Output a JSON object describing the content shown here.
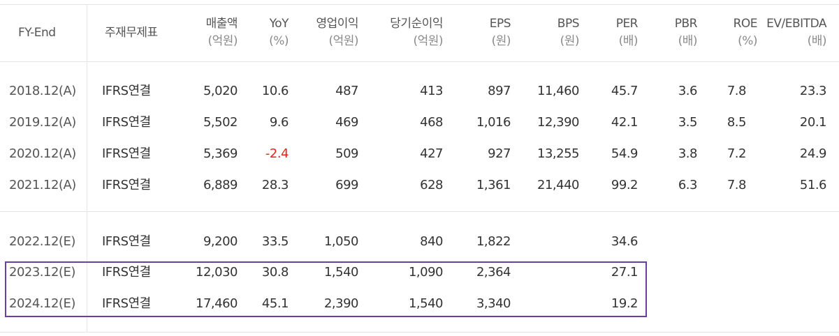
{
  "table": {
    "headers": [
      {
        "line1": "FY-End",
        "line2": ""
      },
      {
        "line1": "주재무제표",
        "line2": ""
      },
      {
        "line1": "매출액",
        "line2": "(억원)"
      },
      {
        "line1": "YoY",
        "line2": "(%)"
      },
      {
        "line1": "영업이익",
        "line2": "(억원)"
      },
      {
        "line1": "당기순이익",
        "line2": "(억원)"
      },
      {
        "line1": "EPS",
        "line2": "(원)"
      },
      {
        "line1": "BPS",
        "line2": "(원)"
      },
      {
        "line1": "PER",
        "line2": "(배)"
      },
      {
        "line1": "PBR",
        "line2": "(배)"
      },
      {
        "line1": "ROE",
        "line2": "(%)"
      },
      {
        "line1": "EV/EBITDA",
        "line2": "(배)"
      }
    ],
    "actual_rows": [
      {
        "fy": "2018.12(A)",
        "gaap": "IFRS연결",
        "sales": "5,020",
        "yoy": "10.6",
        "op": "487",
        "net": "413",
        "eps": "897",
        "bps": "11,460",
        "per": "45.7",
        "pbr": "3.6",
        "roe": "7.8",
        "ev": "23.3"
      },
      {
        "fy": "2019.12(A)",
        "gaap": "IFRS연결",
        "sales": "5,502",
        "yoy": "9.6",
        "op": "469",
        "net": "468",
        "eps": "1,016",
        "bps": "12,390",
        "per": "42.1",
        "pbr": "3.5",
        "roe": "8.5",
        "ev": "20.1"
      },
      {
        "fy": "2020.12(A)",
        "gaap": "IFRS연결",
        "sales": "5,369",
        "yoy": "-2.4",
        "op": "509",
        "net": "427",
        "eps": "927",
        "bps": "13,255",
        "per": "54.9",
        "pbr": "3.8",
        "roe": "7.2",
        "ev": "24.9"
      },
      {
        "fy": "2021.12(A)",
        "gaap": "IFRS연결",
        "sales": "6,889",
        "yoy": "28.3",
        "op": "699",
        "net": "628",
        "eps": "1,361",
        "bps": "21,440",
        "per": "99.2",
        "pbr": "6.3",
        "roe": "7.8",
        "ev": "51.6"
      }
    ],
    "estimate_rows": [
      {
        "fy": "2022.12(E)",
        "gaap": "IFRS연결",
        "sales": "9,200",
        "yoy": "33.5",
        "op": "1,050",
        "net": "840",
        "eps": "1,822",
        "bps": "",
        "per": "34.6",
        "pbr": "",
        "roe": "",
        "ev": ""
      },
      {
        "fy": "2023.12(E)",
        "gaap": "IFRS연결",
        "sales": "12,030",
        "yoy": "30.8",
        "op": "1,540",
        "net": "1,090",
        "eps": "2,364",
        "bps": "",
        "per": "27.1",
        "pbr": "",
        "roe": "",
        "ev": ""
      },
      {
        "fy": "2024.12(E)",
        "gaap": "IFRS연결",
        "sales": "17,460",
        "yoy": "45.1",
        "op": "2,390",
        "net": "1,540",
        "eps": "3,340",
        "bps": "",
        "per": "19.2",
        "pbr": "",
        "roe": "",
        "ev": ""
      }
    ],
    "negative_color": "#e8221b",
    "highlight_color": "#6b3fa0"
  }
}
